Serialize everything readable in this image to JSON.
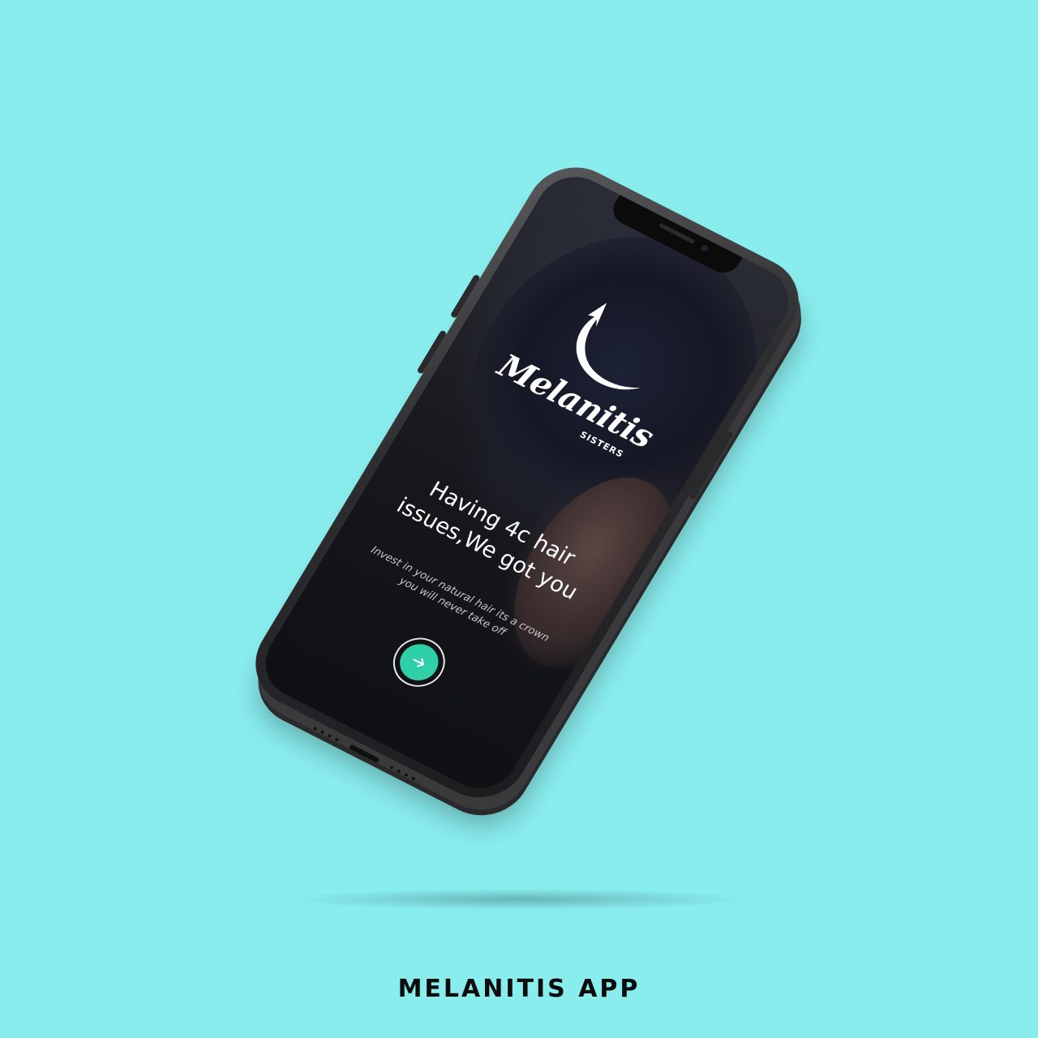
{
  "caption": "MELANITIS APP",
  "app": {
    "logo": {
      "name": "elanitis",
      "initial": "M",
      "subtitle": "SISTERS"
    },
    "headline_line1": "Having 4c hair",
    "headline_line2": "issues,We got you",
    "subtext_line1": "Invest in your natural hair its a crown",
    "subtext_line2": "you will never take off",
    "next_button_icon": "arrow-right-icon"
  },
  "colors": {
    "background": "#89ECED",
    "accent": "#2FD0A8",
    "phone_body": "#2e2e30",
    "text": "#ffffff"
  }
}
